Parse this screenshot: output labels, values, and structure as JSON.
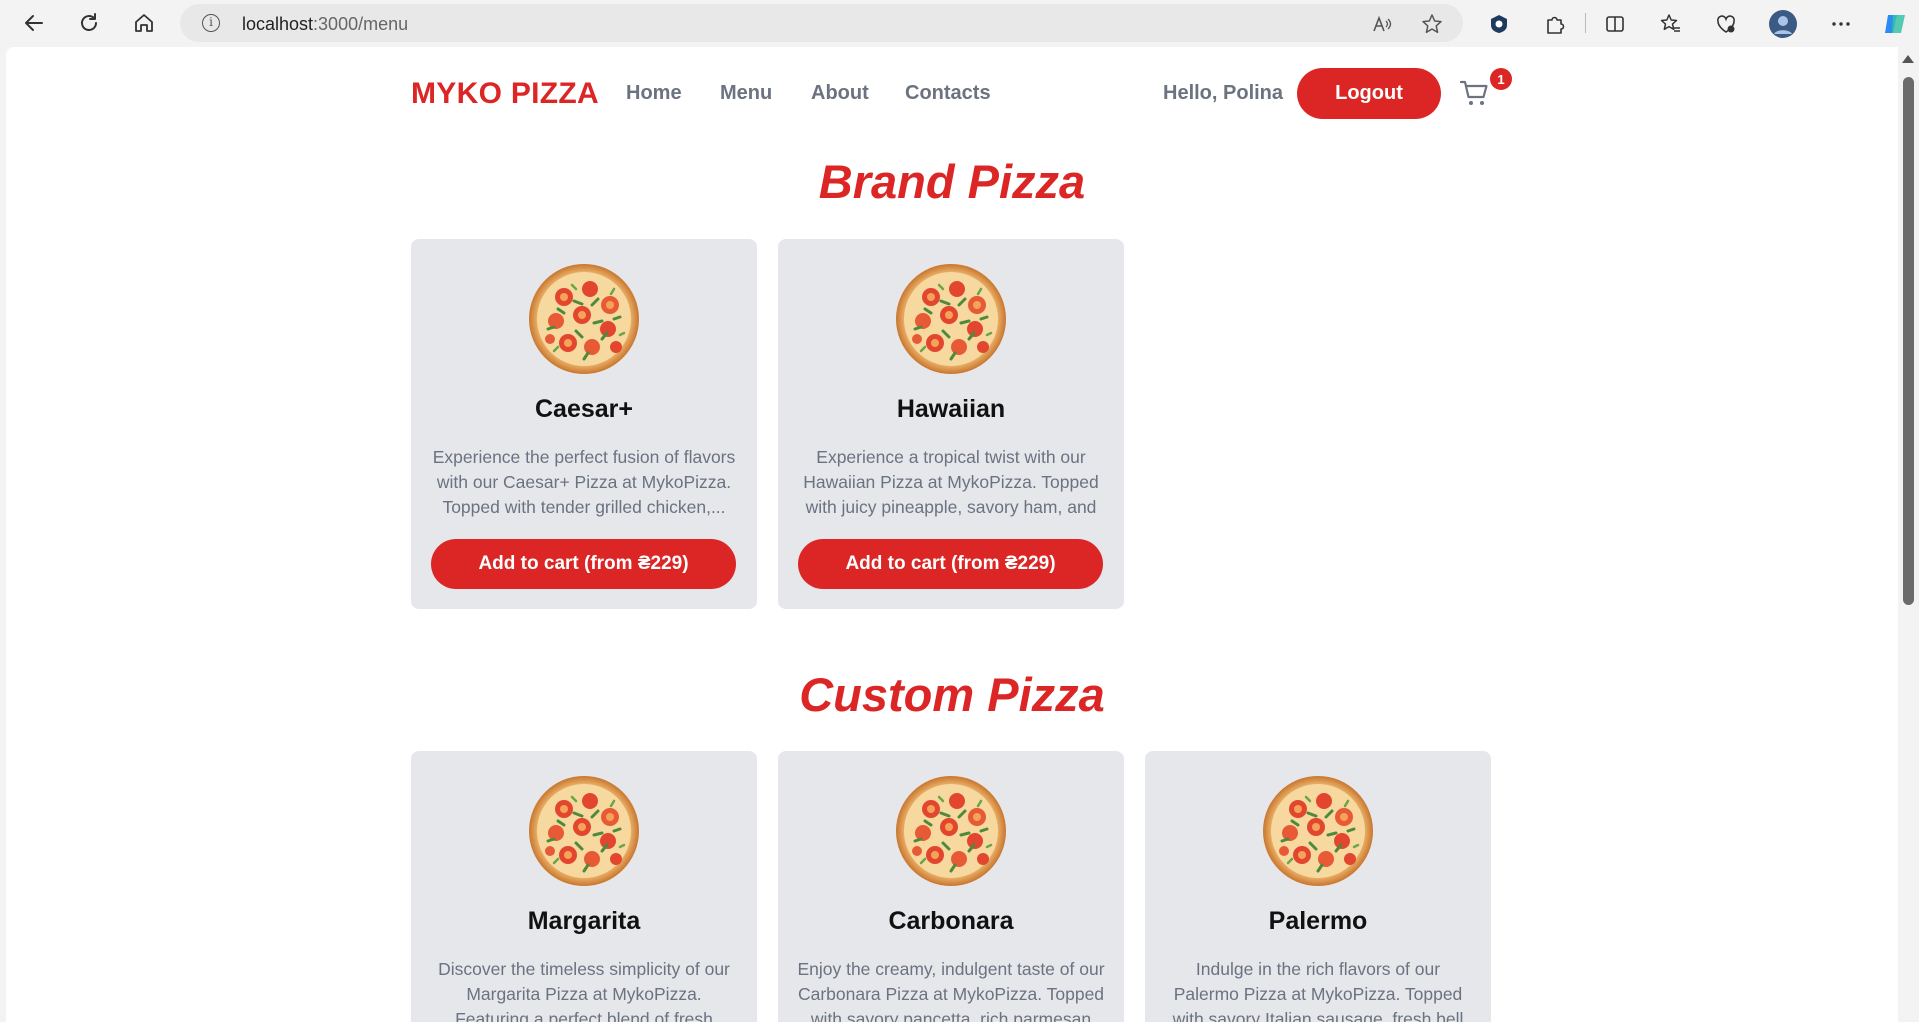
{
  "browser": {
    "url_host": "localhost",
    "url_path": ":3000/menu",
    "info_glyph": "i",
    "icons": [
      "back-arrow-icon",
      "reload-icon",
      "home-icon",
      "info-icon",
      "read-aloud-icon",
      "favorite-star-icon",
      "extension-shield-icon",
      "extensions-puzzle-icon",
      "split-screen-icon",
      "favorites-icon",
      "browser-essentials-icon",
      "profile-avatar-icon",
      "more-menu-icon",
      "copilot-icon"
    ]
  },
  "header": {
    "logo": "MYKO PIZZA",
    "nav": [
      {
        "label": "Home"
      },
      {
        "label": "Menu"
      },
      {
        "label": "About"
      },
      {
        "label": "Contacts"
      }
    ],
    "greeting": "Hello, Polina",
    "logout_label": "Logout",
    "cart_count": "1"
  },
  "sections": [
    {
      "title": "Brand Pizza",
      "items": [
        {
          "name": "Caesar+",
          "description": "Experience the perfect fusion of flavors with our Caesar+ Pizza at MykoPizza. Topped with tender grilled chicken,...",
          "button": "Add to cart (from ₴229)"
        },
        {
          "name": "Hawaiian",
          "description": "Experience a tropical twist with our Hawaiian Pizza at MykoPizza. Topped with juicy pineapple, savory ham, and ...",
          "button": "Add to cart (from ₴229)"
        }
      ]
    },
    {
      "title": "Custom Pizza",
      "items": [
        {
          "name": "Margarita",
          "description": "Discover the timeless simplicity of our Margarita Pizza at MykoPizza. Featuring a perfect blend of fresh",
          "button": ""
        },
        {
          "name": "Carbonara",
          "description": "Enjoy the creamy, indulgent taste of our Carbonara Pizza at MykoPizza. Topped with savory pancetta, rich parmesan",
          "button": ""
        },
        {
          "name": "Palermo",
          "description": "Indulge in the rich flavors of our Palermo Pizza at MykoPizza. Topped with savory Italian sausage, fresh bell",
          "button": ""
        }
      ]
    }
  ],
  "colors": {
    "accent": "#dc2626",
    "card_bg": "#e5e7eb",
    "muted_text": "#6b7280"
  }
}
